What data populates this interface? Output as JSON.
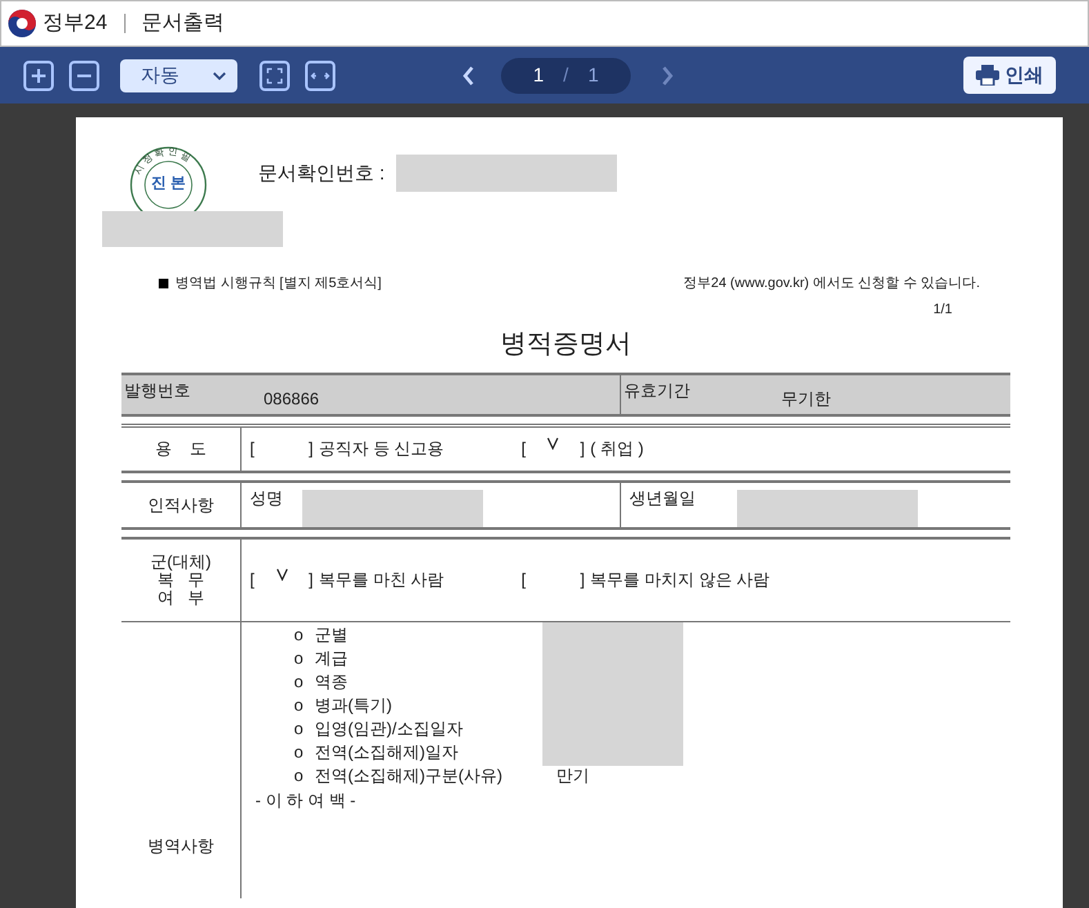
{
  "window": {
    "app": "정부24",
    "title": "문서출력"
  },
  "toolbar": {
    "zoom": "자동",
    "page": "1",
    "separator": "/",
    "pages": "1",
    "prev_disabled": false,
    "next_disabled": true,
    "print": "인쇄"
  },
  "document": {
    "confirm_label": "문서확인번호 :",
    "seal": {
      "ring": "시 청 확 인 필",
      "center": "진 본"
    },
    "form_note": "병역법 시행규칙 [별지 제5호서식]",
    "site_note": "정부24 (www.gov.kr) 에서도 신청할 수 있습니다.",
    "page_no": "1/1",
    "heading": "병적증명서",
    "header_row": [
      {
        "label": "발행번호",
        "value": "086866"
      },
      {
        "label": "유효기간",
        "value": "무기한"
      }
    ],
    "purpose": {
      "label": "용    도",
      "options": [
        {
          "open": "[",
          "close": "]",
          "text": "공직자 등 신고용",
          "checked": false
        },
        {
          "open": "[",
          "close": "]",
          "text": "( 취업 )",
          "checked": true
        }
      ]
    },
    "personal": {
      "label": "인적사항",
      "fields": [
        {
          "label": "성명"
        },
        {
          "label": "생년월일"
        }
      ]
    },
    "service": {
      "label": [
        "군(대체)",
        "복   무",
        "여   부"
      ],
      "options": [
        {
          "open": "[",
          "close": "]",
          "text": "복무를 마친 사람",
          "checked": true
        },
        {
          "open": "[",
          "close": "]",
          "text": "복무를 마치지 않은 사람",
          "checked": false
        }
      ]
    },
    "military": {
      "label": "병역사항",
      "items": [
        {
          "bullet": "o",
          "text": "군별"
        },
        {
          "bullet": "o",
          "text": "계급"
        },
        {
          "bullet": "o",
          "text": "역종"
        },
        {
          "bullet": "o",
          "text": "병과(특기)"
        },
        {
          "bullet": "o",
          "text": "입영(임관)/소집일자"
        },
        {
          "bullet": "o",
          "text": "전역(소집해제)일자"
        },
        {
          "bullet": "o",
          "text": "전역(소집해제)구분(사유)",
          "value": "만기"
        }
      ],
      "end_note": "- 이 하 여 백 -"
    }
  }
}
